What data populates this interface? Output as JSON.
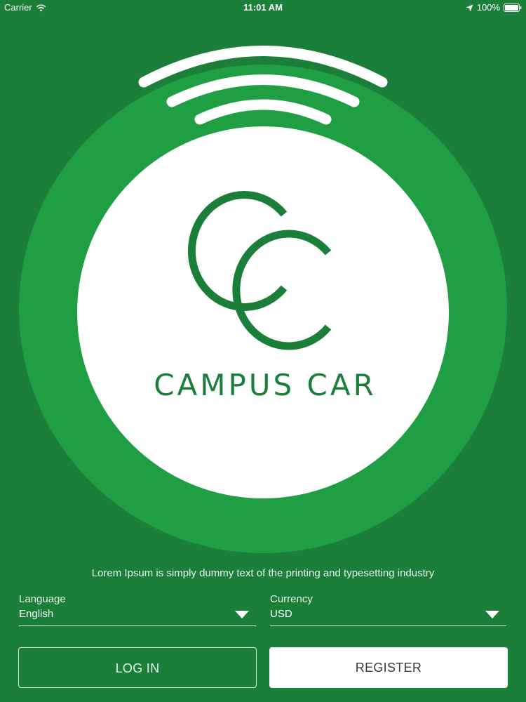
{
  "status_bar": {
    "carrier": "Carrier",
    "time": "11:01 AM",
    "battery": "100%",
    "icons": [
      "wifi-icon",
      "location-arrow-icon",
      "battery-icon"
    ]
  },
  "brand": {
    "monogram": "CC",
    "name": "CAMPUS CAR"
  },
  "tagline": "Lorem Ipsum is simply dummy text of the printing and typesetting industry",
  "language": {
    "label": "Language",
    "value": "English"
  },
  "currency": {
    "label": "Currency",
    "value": "USD"
  },
  "buttons": {
    "login": "LOG IN",
    "register": "REGISTER"
  },
  "colors": {
    "background": "#1b7f3a",
    "ring": "#1f9e44",
    "logo_green": "#1b7f3a",
    "white": "#ffffff"
  }
}
